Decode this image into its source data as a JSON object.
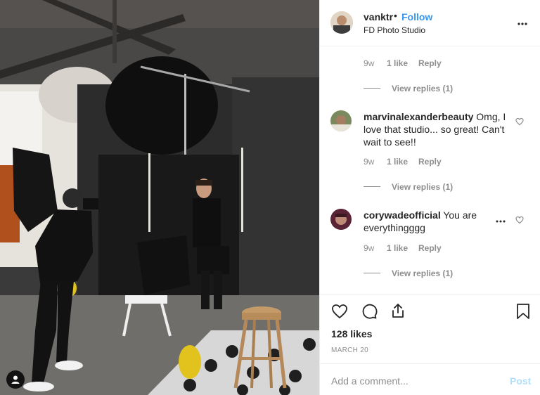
{
  "post": {
    "username": "vanktr",
    "dot": "•",
    "follow_label": "Follow",
    "location": "FD Photo Studio",
    "more_icon": "more-horizontal-icon"
  },
  "reply_thread_1": {
    "time": "9w",
    "likes": "1 like",
    "reply": "Reply",
    "view_replies": "View replies (1)"
  },
  "comments": [
    {
      "username": "marvinalexanderbeauty",
      "text": " Omg, I love that studio... so great! Can't wait to see!!",
      "time": "9w",
      "likes": "1 like",
      "reply": "Reply",
      "view_replies": "View replies (1)"
    },
    {
      "username": "corywadeofficial",
      "text": " You are everythingggg",
      "time": "9w",
      "likes": "1 like",
      "reply": "Reply",
      "view_replies": "View replies (1)"
    }
  ],
  "actions": {
    "like_icon": "heart-icon",
    "comment_icon": "comment-icon",
    "share_icon": "share-icon",
    "save_icon": "bookmark-icon",
    "likes": "128 likes",
    "date": "MARCH 20"
  },
  "add_comment": {
    "placeholder": "Add a comment...",
    "post_label": "Post"
  },
  "colors": {
    "follow": "#3897f0",
    "post_disabled": "#b2dffc",
    "muted": "#8e8e8e",
    "text": "#262626"
  }
}
